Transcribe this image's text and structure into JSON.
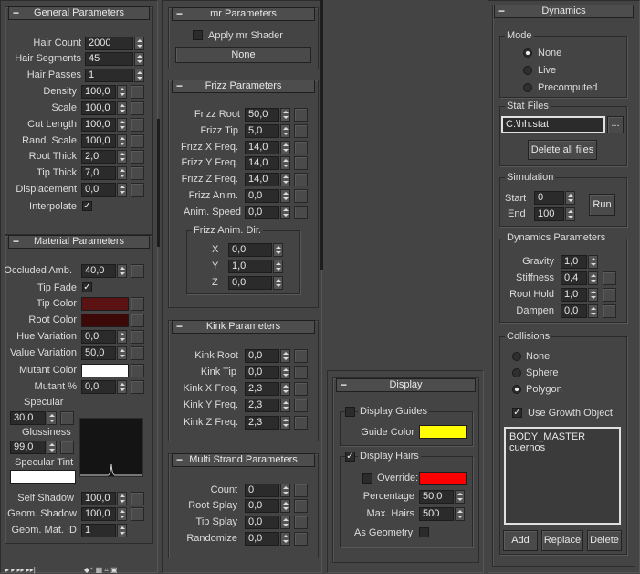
{
  "general": {
    "title": "General Parameters",
    "hair_count": {
      "label": "Hair Count",
      "value": "2000"
    },
    "hair_segments": {
      "label": "Hair Segments",
      "value": "45"
    },
    "hair_passes": {
      "label": "Hair Passes",
      "value": "1"
    },
    "density": {
      "label": "Density",
      "value": "100,0"
    },
    "scale": {
      "label": "Scale",
      "value": "100,0"
    },
    "cut_length": {
      "label": "Cut Length",
      "value": "100,0"
    },
    "rand_scale": {
      "label": "Rand. Scale",
      "value": "100,0"
    },
    "root_thick": {
      "label": "Root Thick",
      "value": "2,0"
    },
    "tip_thick": {
      "label": "Tip Thick",
      "value": "7,0"
    },
    "displacement": {
      "label": "Displacement",
      "value": "0,0"
    },
    "interpolate": {
      "label": "Interpolate",
      "checked": true
    }
  },
  "material": {
    "title": "Material Parameters",
    "occluded_amb": {
      "label": "Occluded Amb.",
      "value": "40,0"
    },
    "tip_fade": {
      "label": "Tip Fade",
      "checked": true
    },
    "tip_color": {
      "label": "Tip Color",
      "color": "#5a1212"
    },
    "root_color": {
      "label": "Root Color",
      "color": "#3d0808"
    },
    "hue_variation": {
      "label": "Hue Variation",
      "value": "0,0"
    },
    "value_variation": {
      "label": "Value Variation",
      "value": "50,0"
    },
    "mutant_color": {
      "label": "Mutant Color",
      "color": "#ffffff"
    },
    "mutant_pct": {
      "label": "Mutant %",
      "value": "0,0"
    },
    "specular": {
      "label": "Specular",
      "value": "30,0"
    },
    "glossiness": {
      "label": "Glossiness",
      "value": "99,0"
    },
    "specular_tint": {
      "label": "Specular Tint",
      "color": "#ffffff"
    },
    "self_shadow": {
      "label": "Self Shadow",
      "value": "100,0"
    },
    "geom_shadow": {
      "label": "Geom. Shadow",
      "value": "100,0"
    },
    "geom_mat_id": {
      "label": "Geom. Mat. ID",
      "value": "1"
    }
  },
  "mr": {
    "title": "mr Parameters",
    "apply_shader": {
      "label": "Apply mr Shader",
      "checked": false
    },
    "shader_button": "None"
  },
  "frizz": {
    "title": "Frizz Parameters",
    "root": {
      "label": "Frizz Root",
      "value": "50,0"
    },
    "tip": {
      "label": "Frizz Tip",
      "value": "5,0"
    },
    "x_freq": {
      "label": "Frizz X Freq.",
      "value": "14,0"
    },
    "y_freq": {
      "label": "Frizz Y Freq.",
      "value": "14,0"
    },
    "z_freq": {
      "label": "Frizz Z Freq.",
      "value": "14,0"
    },
    "anim": {
      "label": "Frizz Anim.",
      "value": "0,0"
    },
    "anim_speed": {
      "label": "Anim. Speed",
      "value": "0,0"
    },
    "anim_dir": {
      "title": "Frizz Anim. Dir.",
      "x": {
        "label": "X",
        "value": "0,0"
      },
      "y": {
        "label": "Y",
        "value": "1,0"
      },
      "z": {
        "label": "Z",
        "value": "0,0"
      }
    }
  },
  "kink": {
    "title": "Kink Parameters",
    "root": {
      "label": "Kink Root",
      "value": "0,0"
    },
    "tip": {
      "label": "Kink Tip",
      "value": "0,0"
    },
    "x_freq": {
      "label": "Kink X Freq.",
      "value": "2,3"
    },
    "y_freq": {
      "label": "Kink Y Freq.",
      "value": "2,3"
    },
    "z_freq": {
      "label": "Kink Z Freq.",
      "value": "2,3"
    }
  },
  "multistrand": {
    "title": "Multi Strand Parameters",
    "count": {
      "label": "Count",
      "value": "0"
    },
    "root_splay": {
      "label": "Root Splay",
      "value": "0,0"
    },
    "tip_splay": {
      "label": "Tip Splay",
      "value": "0,0"
    },
    "randomize": {
      "label": "Randomize",
      "value": "0,0"
    }
  },
  "display": {
    "title": "Display",
    "display_guides": {
      "label": "Display Guides",
      "checked": false
    },
    "guide_color": {
      "label": "Guide Color",
      "color": "#ffff00"
    },
    "display_hairs": {
      "label": "Display Hairs",
      "checked": true
    },
    "override": {
      "label": "Override:",
      "checked": false,
      "color": "#ff0000"
    },
    "percentage": {
      "label": "Percentage",
      "value": "50,0"
    },
    "max_hairs": {
      "label": "Max. Hairs",
      "value": "500"
    },
    "as_geometry": {
      "label": "As Geometry",
      "checked": false
    }
  },
  "dynamics": {
    "title": "Dynamics",
    "mode": {
      "title": "Mode",
      "options": [
        "None",
        "Live",
        "Precomputed"
      ],
      "selected": "None"
    },
    "stat_files": {
      "title": "Stat Files",
      "path": "C:\\hh.stat",
      "browse": "...",
      "delete_all": "Delete all files"
    },
    "simulation": {
      "title": "Simulation",
      "start": {
        "label": "Start",
        "value": "0"
      },
      "end": {
        "label": "End",
        "value": "100"
      },
      "run": "Run"
    },
    "params": {
      "title": "Dynamics Parameters",
      "gravity": {
        "label": "Gravity",
        "value": "1,0"
      },
      "stiffness": {
        "label": "Stiffness",
        "value": "0,4"
      },
      "root_hold": {
        "label": "Root Hold",
        "value": "1,0"
      },
      "dampen": {
        "label": "Dampen",
        "value": "0,0"
      }
    },
    "collisions": {
      "title": "Collisions",
      "options": [
        "None",
        "Sphere",
        "Polygon"
      ],
      "selected": "Polygon",
      "use_growth": {
        "label": "Use Growth Object",
        "checked": true
      },
      "objects": [
        "BODY_MASTER",
        "cuernos"
      ],
      "add": "Add",
      "replace": "Replace",
      "delete": "Delete"
    }
  },
  "colors": {
    "panel_bg": "#444444",
    "field_bg": "#2b2b2b"
  }
}
